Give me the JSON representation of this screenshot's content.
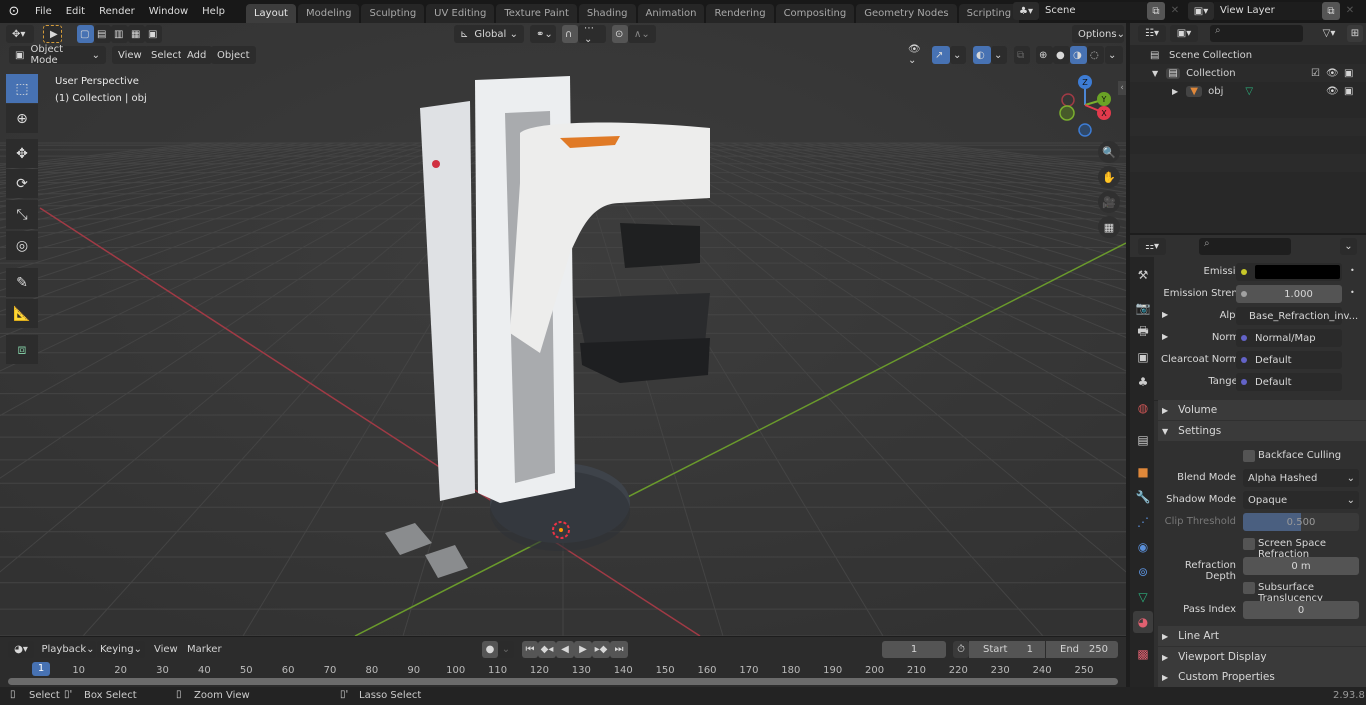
{
  "topbar": {
    "menus": [
      "File",
      "Edit",
      "Render",
      "Window",
      "Help"
    ],
    "workspaces": [
      "Layout",
      "Modeling",
      "Sculpting",
      "UV Editing",
      "Texture Paint",
      "Shading",
      "Animation",
      "Rendering",
      "Compositing",
      "Geometry Nodes",
      "Scripting"
    ],
    "active_workspace": "Layout",
    "add_workspace": "+",
    "scene_label": "Scene",
    "view_layer_label": "View Layer"
  },
  "viewport": {
    "mode": "Object Mode",
    "menus": [
      "View",
      "Select",
      "Add",
      "Object"
    ],
    "transform_orientation": "Global",
    "options_label": "Options",
    "overlay_title": "User Perspective",
    "overlay_subtitle": "(1) Collection | obj",
    "gizmo": {
      "x": "X",
      "y": "Y",
      "z": "Z"
    },
    "tools": [
      "select-box",
      "cursor",
      "move",
      "rotate",
      "scale",
      "transform",
      "annotate",
      "measure",
      "add-cube"
    ]
  },
  "outliner": {
    "scene_collection": "Scene Collection",
    "collection": "Collection",
    "object": "obj"
  },
  "properties": {
    "rows": [
      {
        "label": "Emission",
        "value": "",
        "socket_color": "#c7c729",
        "expand": false
      },
      {
        "label": "Emission Strengt",
        "value": "1.000",
        "socket_color": "#a1a1a1",
        "expand": false
      },
      {
        "label": "Alpha",
        "value": "Base_Refraction_inv...",
        "socket_color": "#a1a1a1",
        "expand": true
      },
      {
        "label": "Normal",
        "value": "Normal/Map",
        "socket_color": "#6363c7",
        "expand": true
      },
      {
        "label": "Clearcoat Normal",
        "value": "Default",
        "socket_color": "#6363c7",
        "expand": false
      },
      {
        "label": "Tangent",
        "value": "Default",
        "socket_color": "#6363c7",
        "expand": false
      }
    ],
    "sections": {
      "volume": "Volume",
      "settings": "Settings",
      "line_art": "Line Art",
      "viewport_display": "Viewport Display",
      "custom_properties": "Custom Properties"
    },
    "settings": {
      "backface_culling": "Backface Culling",
      "blend_mode_label": "Blend Mode",
      "blend_mode": "Alpha Hashed",
      "shadow_mode_label": "Shadow Mode",
      "shadow_mode": "Opaque",
      "clip_threshold_label": "Clip Threshold",
      "clip_threshold": "0.500",
      "clip_threshold_fraction": 0.5,
      "ssr": "Screen Space Refraction",
      "refraction_depth_label": "Refraction Depth",
      "refraction_depth": "0 m",
      "subsurface": "Subsurface Translucency",
      "pass_index_label": "Pass Index",
      "pass_index": "0"
    }
  },
  "timeline": {
    "menus": [
      "Playback",
      "Keying",
      "View",
      "Marker"
    ],
    "current_frame": "1",
    "start_label": "Start",
    "start": "1",
    "end_label": "End",
    "end": "250",
    "ticks": [
      "10",
      "20",
      "30",
      "40",
      "50",
      "60",
      "70",
      "80",
      "90",
      "100",
      "110",
      "120",
      "130",
      "140",
      "150",
      "160",
      "170",
      "180",
      "190",
      "200",
      "210",
      "220",
      "230",
      "240",
      "250"
    ]
  },
  "statusbar": {
    "items": [
      "Select",
      "Box Select",
      "Zoom View",
      "Lasso Select"
    ],
    "version": "2.93.8"
  }
}
